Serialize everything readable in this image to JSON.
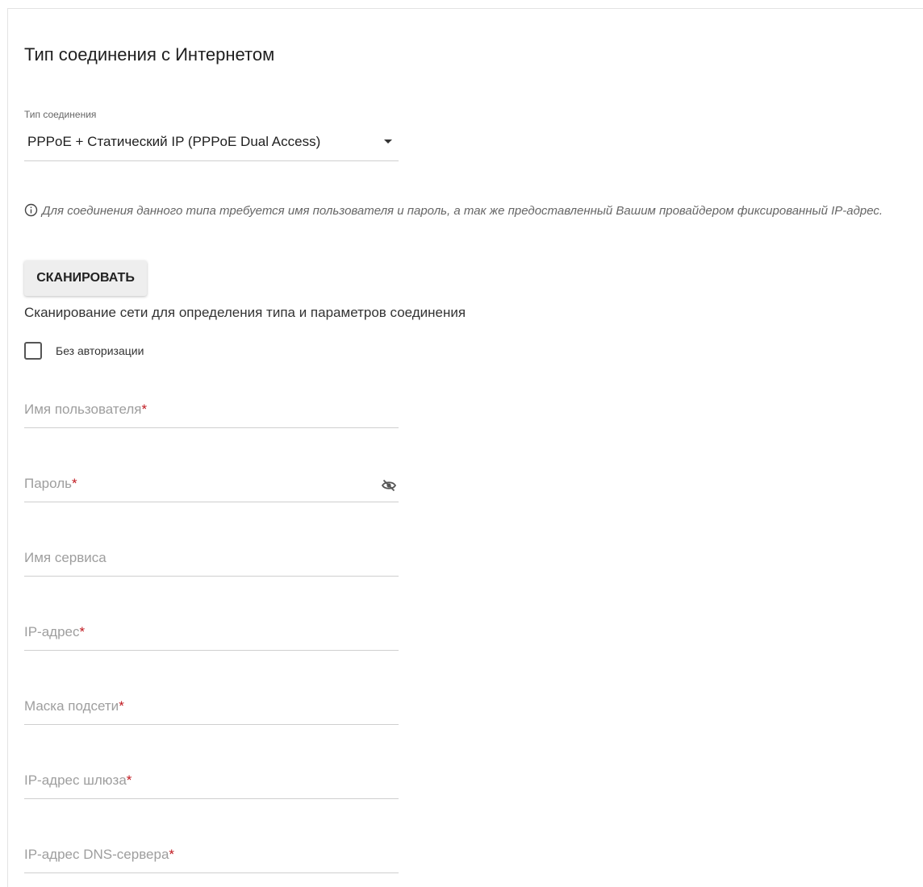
{
  "section_title": "Тип соединения с Интернетом",
  "connection_type": {
    "label": "Тип соединения",
    "value": "PPPoE + Статический IP (PPPoE Dual Access)"
  },
  "info_text": "Для соединения данного типа требуется имя пользователя и пароль, а так же предоставленный Вашим провайдером фиксированный IP-адрес.",
  "scan": {
    "button_label": "СКАНИРОВАТЬ",
    "description": "Сканирование сети для определения типа и параметров соединения"
  },
  "no_auth": {
    "label": "Без авторизации",
    "checked": false
  },
  "fields": {
    "username": {
      "placeholder": "Имя пользователя",
      "required_mark": "*"
    },
    "password": {
      "placeholder": "Пароль",
      "required_mark": "*"
    },
    "service_name": {
      "placeholder": "Имя сервиса"
    },
    "ip_address": {
      "placeholder": "IP-адрес",
      "required_mark": "*"
    },
    "subnet_mask": {
      "placeholder": "Маска подсети",
      "required_mark": "*"
    },
    "gateway_ip": {
      "placeholder": "IP-адрес шлюза",
      "required_mark": "*"
    },
    "dns_ip": {
      "placeholder": "IP-адрес DNS-сервера",
      "required_mark": "*"
    }
  },
  "icons": {
    "info": "info-circle-icon",
    "dropdown": "caret-down-icon",
    "password_visibility": "eye-off-icon"
  },
  "colors": {
    "required": "#c0181f",
    "placeholder": "#9e9e9e",
    "underline": "#cfcfcf"
  }
}
